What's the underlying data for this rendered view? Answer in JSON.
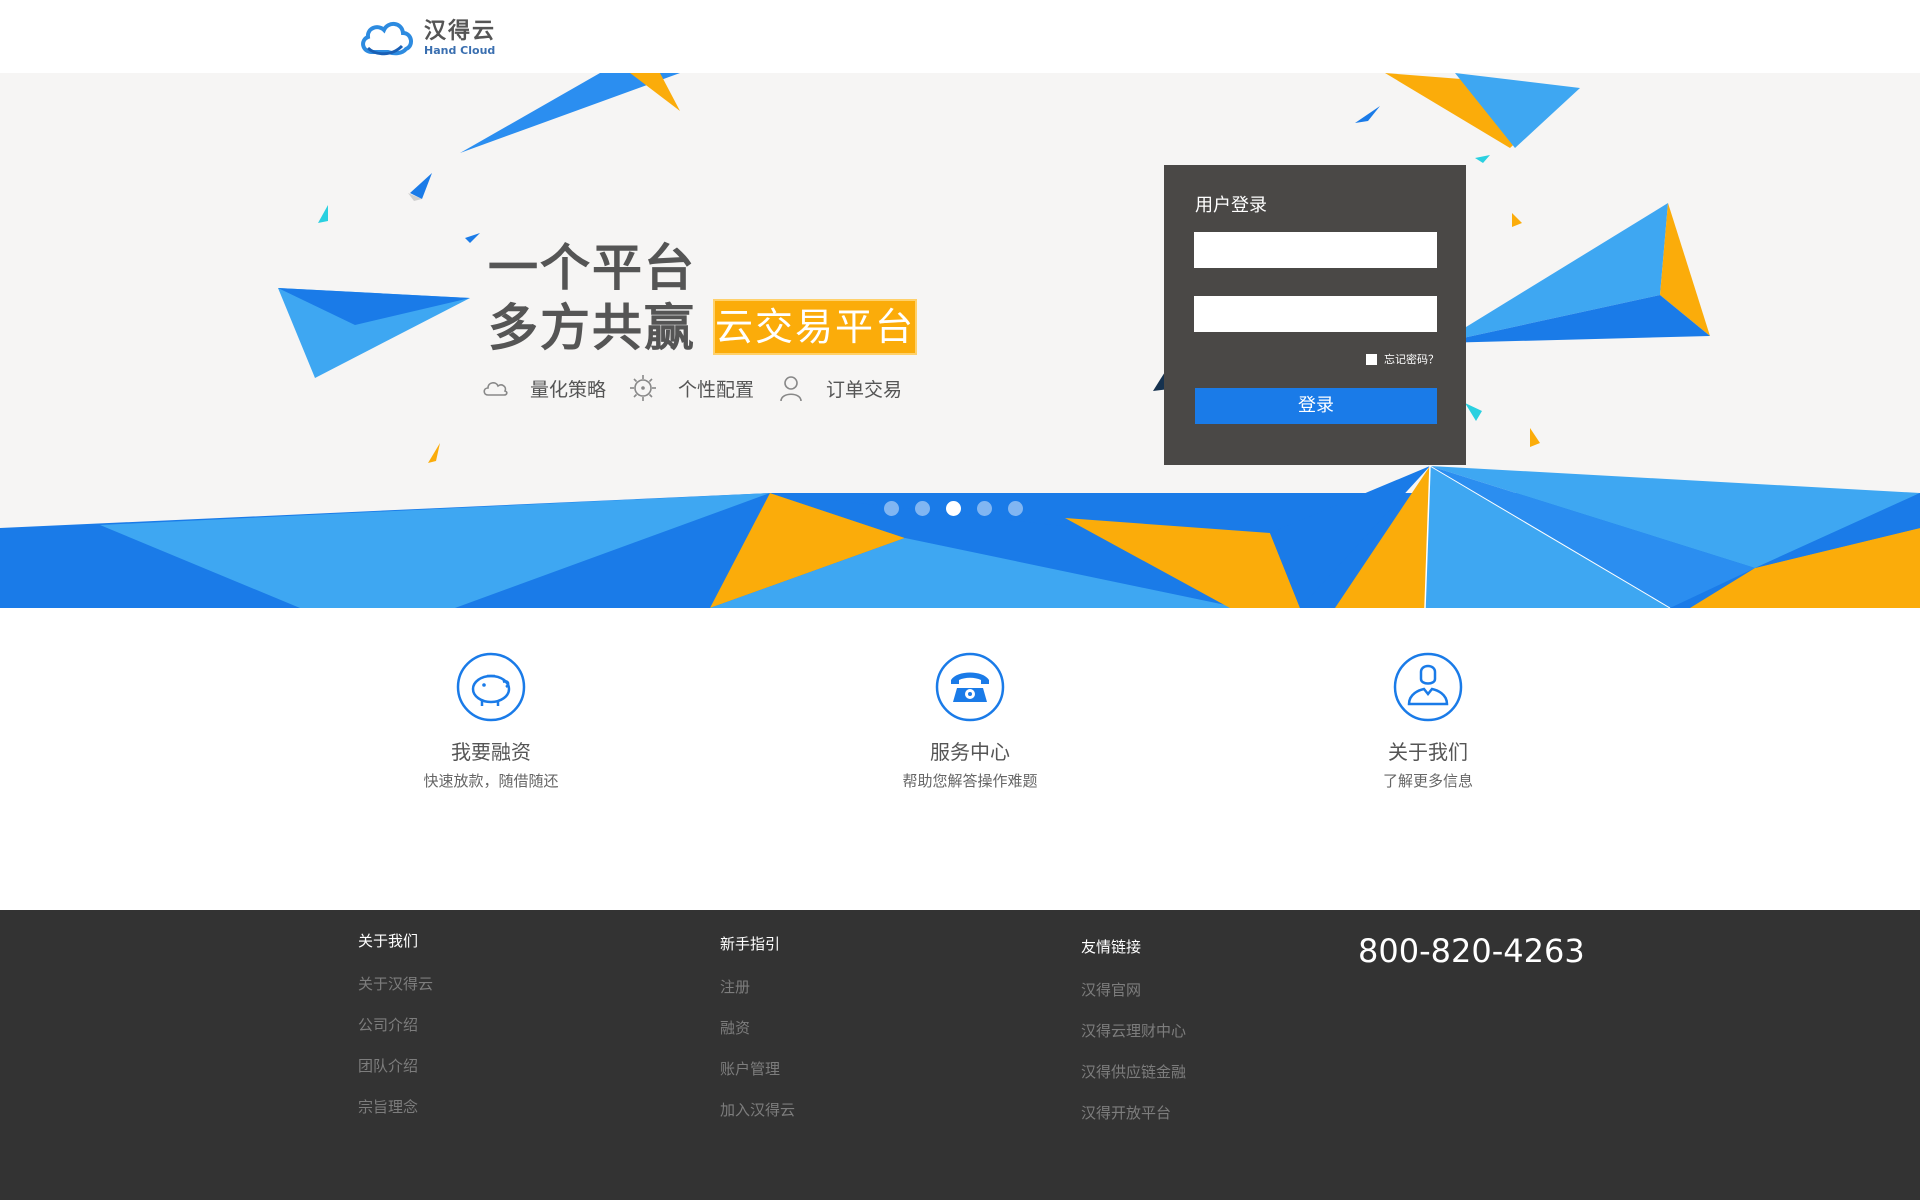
{
  "header": {
    "logo_cn": "汉得云",
    "logo_en": "Hand Cloud"
  },
  "hero": {
    "title_line1": "一个平台",
    "title_line2": "多方共赢",
    "badge": "云交易平台",
    "features": [
      {
        "icon": "cloud-icon",
        "label": "量化策略"
      },
      {
        "icon": "gear-icon",
        "label": "个性配置"
      },
      {
        "icon": "user-icon",
        "label": "订单交易"
      }
    ],
    "carousel": {
      "count": 5,
      "active": 3
    }
  },
  "login": {
    "title": "用户登录",
    "username_value": "",
    "password_value": "",
    "remember_label": "忘记密码？",
    "submit_label": "登录"
  },
  "services": [
    {
      "icon": "piggy-bank-icon",
      "title": "我要融资",
      "subtitle": "快速放款，随借随还"
    },
    {
      "icon": "telephone-icon",
      "title": "服务中心",
      "subtitle": "帮助您解答操作难题"
    },
    {
      "icon": "person-icon",
      "title": "关于我们",
      "subtitle": "了解更多信息"
    }
  ],
  "footer": {
    "columns": [
      {
        "title": "关于我们",
        "links": [
          "关于汉得云",
          "公司介绍",
          "团队介绍",
          "宗旨理念"
        ]
      },
      {
        "title": "新手指引",
        "links": [
          "注册",
          "融资",
          "账户管理",
          "加入汉得云"
        ]
      },
      {
        "title": "友情链接",
        "links": [
          "汉得官网",
          "汉得云理财中心",
          "汉得供应链金融",
          "汉得开放平台"
        ]
      }
    ],
    "phone": "800-820-4263"
  },
  "colors": {
    "accent_blue": "#1a7be8",
    "light_blue": "#3ea7f2",
    "accent_orange": "#fbac0a",
    "login_panel": "#4a4846",
    "footer_bg": "#333333"
  }
}
